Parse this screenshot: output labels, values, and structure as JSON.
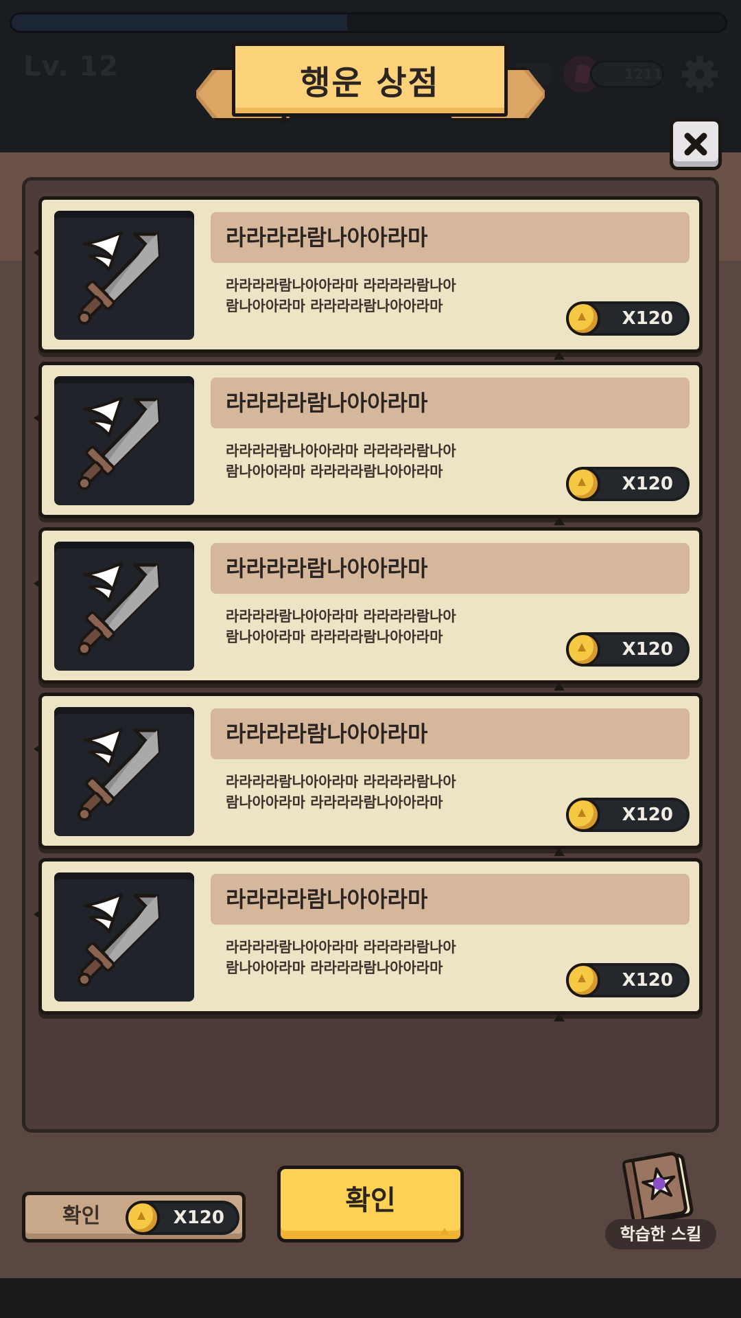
{
  "hud": {
    "level": "Lv. 12",
    "energy": "1211",
    "xp_progress": 0.47
  },
  "shop": {
    "title": "행운 상점",
    "close_icon": "close-icon"
  },
  "items": [
    {
      "name": "라라라라람나아아라마",
      "desc_line1": "라라라라람나아아라마 라라라라람나아",
      "desc_line2": "람나아아라마 라라라라람나아아라마",
      "price": "X120",
      "icon": "sword-icon"
    },
    {
      "name": "라라라라람나아아라마",
      "desc_line1": "라라라라람나아아라마 라라라라람나아",
      "desc_line2": "람나아아라마 라라라라람나아아라마",
      "price": "X120",
      "icon": "sword-icon"
    },
    {
      "name": "라라라라람나아아라마",
      "desc_line1": "라라라라람나아아라마 라라라라람나아",
      "desc_line2": "람나아아라마 라라라라람나아아라마",
      "price": "X120",
      "icon": "sword-icon"
    },
    {
      "name": "라라라라람나아아라마",
      "desc_line1": "라라라라람나아아라마 라라라라람나아",
      "desc_line2": "람나아아라마 라라라라람나아아라마",
      "price": "X120",
      "icon": "sword-icon"
    },
    {
      "name": "라라라라람나아아라마",
      "desc_line1": "라라라라람나아아라마 라라라라람나아",
      "desc_line2": "람나아아라마 라라라라람나아아라마",
      "price": "X120",
      "icon": "sword-icon"
    }
  ],
  "footer": {
    "cost_button_label": "확인",
    "cost_value": "X120",
    "confirm_label": "확인",
    "skill_label": "학습한 스킬",
    "skill_icon": "spell-book-icon"
  },
  "colors": {
    "banner": "#fcd27b",
    "confirm": "#fed255",
    "card": "#ede3c5",
    "name_box": "#d5b89c",
    "coin": "#f6c945"
  }
}
